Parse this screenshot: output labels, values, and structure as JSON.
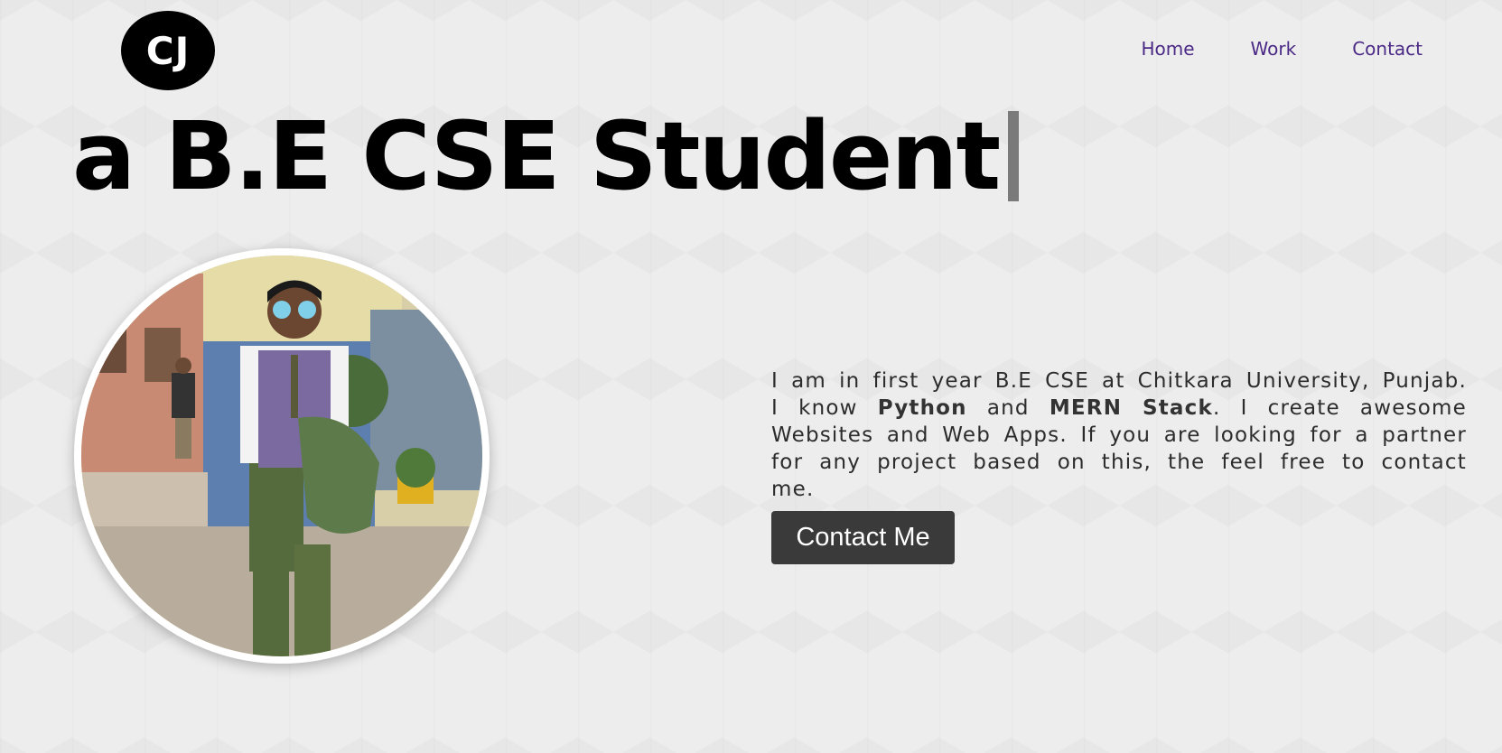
{
  "logo": {
    "text": "CJ"
  },
  "nav": {
    "items": [
      {
        "label": "Home"
      },
      {
        "label": "Work"
      },
      {
        "label": "Contact"
      }
    ]
  },
  "hero": {
    "headline": "a B.E CSE Student"
  },
  "about": {
    "part1": "I am in first year B.E CSE at Chitkara University, Punjab. I know ",
    "skill1": "Python",
    "part2": " and ",
    "skill2": "MERN Stack",
    "part3": ". I create awesome Websites and Web Apps. If you are looking for a partner for any project based on this, the feel free to contact me."
  },
  "cta": {
    "label": "Contact Me"
  },
  "colors": {
    "background": "#ededed",
    "nav_link": "#4b2a86",
    "button_bg": "#3a3a3a",
    "logo_bg": "#000000"
  }
}
